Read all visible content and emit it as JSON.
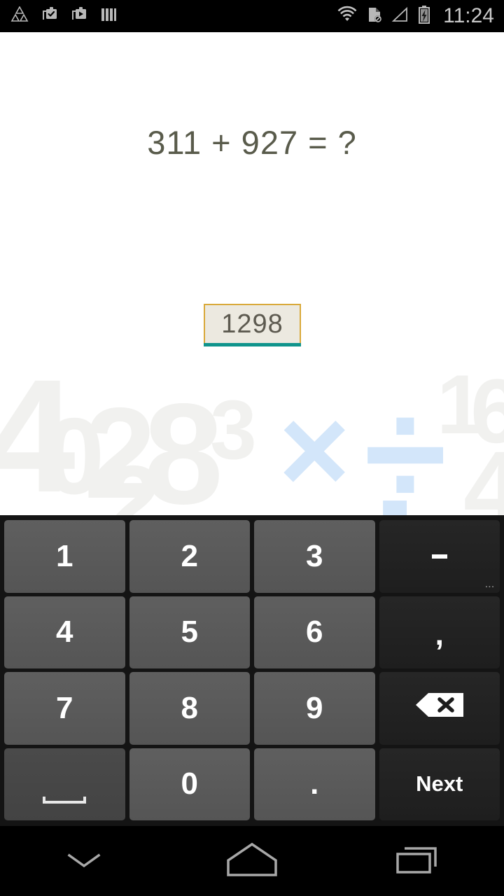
{
  "status_bar": {
    "left_icons": [
      {
        "name": "triangle-logo-icon",
        "label": "app-logo"
      },
      {
        "name": "clipboard-check-icon",
        "label": "task-complete"
      },
      {
        "name": "briefcase-play-icon",
        "label": "media-notification"
      },
      {
        "name": "bars-icon",
        "label": "vertical-bars"
      }
    ],
    "right_icons": [
      {
        "name": "wifi-icon",
        "label": "wifi"
      },
      {
        "name": "sim-card-missing-icon",
        "label": "no-sim"
      },
      {
        "name": "signal-empty-icon",
        "label": "no-signal"
      },
      {
        "name": "battery-charging-icon",
        "label": "battery-charging"
      }
    ],
    "clock": "11:24"
  },
  "main": {
    "question": "311 + 927 = ?",
    "answer_value": "1298",
    "answer_placeholder": "",
    "colors": {
      "question_text": "#595b4b",
      "field_background": "#ece9e0",
      "field_border": "#d9a93a",
      "field_underline": "#10948c",
      "watermark_number": "#f1f1ef",
      "watermark_operator": "#d3e6fa"
    },
    "watermark": {
      "numbers": [
        "4",
        "0",
        "2",
        "3",
        "8",
        "3",
        "1",
        "6",
        "4"
      ],
      "operators": [
        "×",
        "÷"
      ]
    }
  },
  "keyboard": {
    "rows": [
      [
        {
          "label": "1",
          "name": "key-1",
          "type": "num"
        },
        {
          "label": "2",
          "name": "key-2",
          "type": "num"
        },
        {
          "label": "3",
          "name": "key-3",
          "type": "num"
        },
        {
          "label": "-",
          "name": "key-minus",
          "type": "dark",
          "hint": "..."
        }
      ],
      [
        {
          "label": "4",
          "name": "key-4",
          "type": "num"
        },
        {
          "label": "5",
          "name": "key-5",
          "type": "num"
        },
        {
          "label": "6",
          "name": "key-6",
          "type": "num"
        },
        {
          "label": ",",
          "name": "key-comma",
          "type": "dark"
        }
      ],
      [
        {
          "label": "7",
          "name": "key-7",
          "type": "num"
        },
        {
          "label": "8",
          "name": "key-8",
          "type": "num"
        },
        {
          "label": "9",
          "name": "key-9",
          "type": "num"
        },
        {
          "label": "",
          "name": "key-backspace",
          "type": "icon",
          "icon": "backspace-icon"
        }
      ],
      [
        {
          "label": "",
          "name": "key-space",
          "type": "space",
          "icon": "space-bar-icon"
        },
        {
          "label": "0",
          "name": "key-0",
          "type": "num"
        },
        {
          "label": ".",
          "name": "key-period",
          "type": "num"
        },
        {
          "label": "Next",
          "name": "key-next",
          "type": "action"
        }
      ]
    ],
    "minus_hint": "...",
    "next_label": "Next"
  },
  "nav_bar": {
    "buttons": [
      {
        "name": "hide-keyboard-icon",
        "label": "back"
      },
      {
        "name": "home-icon",
        "label": "home"
      },
      {
        "name": "recents-icon",
        "label": "recents"
      }
    ]
  }
}
